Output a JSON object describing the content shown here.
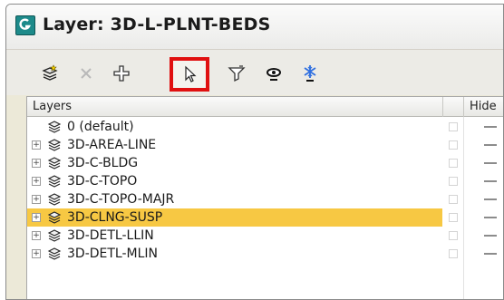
{
  "window": {
    "title": "Layer: 3D-L-PLNT-BEDS",
    "accent_color": "#1d8a8a"
  },
  "toolbar": {
    "buttons": [
      {
        "name": "create-layer-button",
        "icon": "new-layer-icon",
        "enabled": true
      },
      {
        "name": "delete-layer-button",
        "icon": "delete-x-icon",
        "enabled": false
      },
      {
        "name": "add-selection-button",
        "icon": "add-plus-icon",
        "enabled": true
      },
      {
        "name": "select-objects-button",
        "icon": "select-cursor-icon",
        "enabled": true,
        "highlighted": true
      },
      {
        "name": "highlight-selected-button",
        "icon": "highlight-funnel-icon",
        "enabled": true
      },
      {
        "name": "hide-all-button",
        "icon": "hide-eye-icon",
        "enabled": true
      },
      {
        "name": "freeze-all-button",
        "icon": "snowflake-icon",
        "enabled": true
      }
    ],
    "highlight_color": "#e01010"
  },
  "columns": [
    {
      "label": "Layers"
    },
    {
      "label": ""
    },
    {
      "label": "Hide"
    }
  ],
  "rows": [
    {
      "label": "0 (default)",
      "expandable": false,
      "selected": false
    },
    {
      "label": "3D-AREA-LINE",
      "expandable": true,
      "selected": false
    },
    {
      "label": "3D-C-BLDG",
      "expandable": true,
      "selected": false
    },
    {
      "label": "3D-C-TOPO",
      "expandable": true,
      "selected": false
    },
    {
      "label": "3D-C-TOPO-MAJR",
      "expandable": true,
      "selected": false
    },
    {
      "label": "3D-CLNG-SUSP",
      "expandable": true,
      "selected": true
    },
    {
      "label": "3D-DETL-LLIN",
      "expandable": true,
      "selected": false
    },
    {
      "label": "3D-DETL-MLIN",
      "expandable": true,
      "selected": false
    }
  ],
  "selection_color": "#f7c843",
  "expander_glyph": "+"
}
